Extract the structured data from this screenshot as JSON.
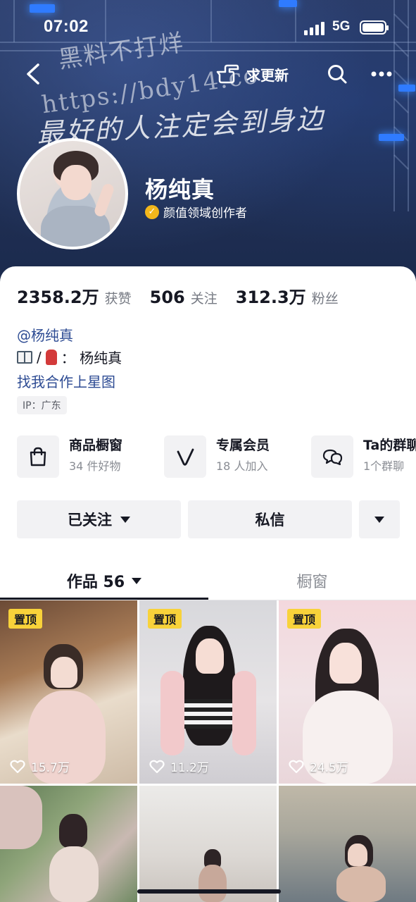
{
  "status_bar": {
    "time": "07:02",
    "network": "5G"
  },
  "watermark": {
    "line1": "黑料不打烊",
    "line2": "https://bdy14.co",
    "handwriting": "最好的人注定会到身边"
  },
  "nav": {
    "update_label": "求更新"
  },
  "profile": {
    "name": "杨纯真",
    "creator_label": "颜值领域创作者",
    "stats": [
      {
        "value": "2358.2万",
        "label": "获赞"
      },
      {
        "value": "506",
        "label": "关注"
      },
      {
        "value": "312.3万",
        "label": "粉丝"
      }
    ],
    "bio": {
      "handle": "@杨纯真",
      "line2_separator": "/",
      "line2_text": "： 杨纯真",
      "line3": "找我合作上星图",
      "ip": "IP：广东"
    }
  },
  "features": [
    {
      "title": "商品橱窗",
      "sub": "34 件好物",
      "icon": "shopping-bag-icon"
    },
    {
      "title": "专属会员",
      "sub": "18 人加入",
      "icon": "vip-v-icon"
    },
    {
      "title": "Ta的群聊",
      "sub": "1个群聊",
      "icon": "group-chat-icon"
    }
  ],
  "actions": {
    "follow_label": "已关注",
    "message_label": "私信"
  },
  "tabs": [
    {
      "label": "作品 56"
    },
    {
      "label": "橱窗"
    }
  ],
  "grid": [
    {
      "pinned": "置顶",
      "likes": "15.7万"
    },
    {
      "pinned": "置顶",
      "likes": "11.2万"
    },
    {
      "pinned": "置顶",
      "likes": "24.5万"
    }
  ],
  "colors": {
    "banner": "#223257",
    "link": "#2d4b93",
    "pin": "#f8d23a",
    "verified": "#f3b71b"
  }
}
